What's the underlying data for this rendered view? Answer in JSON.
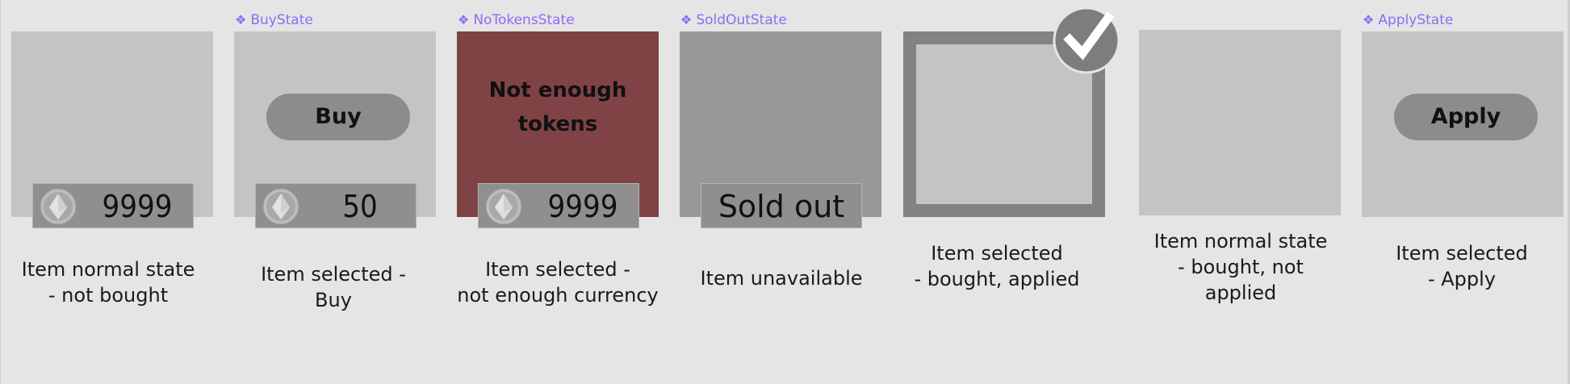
{
  "variants": [
    {
      "component": "",
      "price": "9999",
      "caption": [
        "Item normal state",
        "- not bought"
      ]
    },
    {
      "component": "BuyState",
      "price": "50",
      "button": "Buy",
      "caption": [
        "Item selected -",
        "Buy"
      ]
    },
    {
      "component": "NoTokensState",
      "price": "9999",
      "message": [
        "Not enough",
        "tokens"
      ],
      "caption": [
        "Item selected -",
        "not enough currency"
      ]
    },
    {
      "component": "SoldOutState",
      "status": "Sold out",
      "caption": [
        "Item unavailable"
      ]
    },
    {
      "component": "",
      "caption": [
        "Item selected",
        "- bought, applied"
      ]
    },
    {
      "component": "",
      "caption": [
        "Item normal state",
        "- bought, not",
        "applied"
      ]
    },
    {
      "component": "ApplyState",
      "button": "Apply",
      "caption": [
        "Item selected",
        "- Apply"
      ]
    }
  ],
  "component_glyph": "❖",
  "icons": {
    "coin": "token-coin-icon",
    "check": "checkmark-icon",
    "component": "component-icon"
  },
  "colors": {
    "canvas": "#e5e5e5",
    "card": "#c4c4c4",
    "card_no_tokens": "#7f4346",
    "card_sold_out": "#989898",
    "component_label": "#8b6cf7",
    "selection_border": "#828282"
  }
}
